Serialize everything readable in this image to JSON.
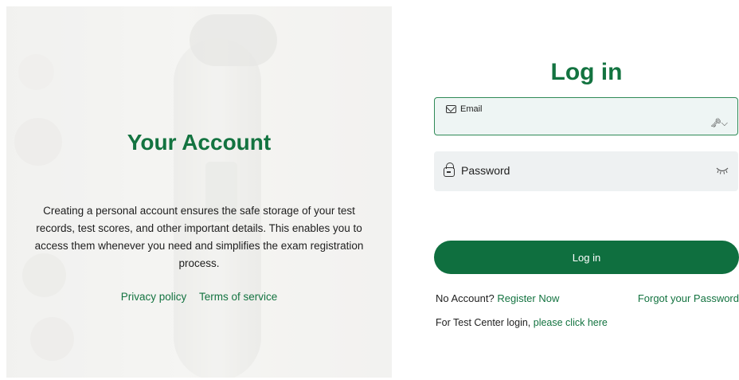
{
  "left_panel": {
    "title": "Your Account",
    "description": "Creating a personal account ensures the safe storage of your test records, test scores, and other important details. This enables you to access them whenever you need and simplifies the exam registration process.",
    "links": {
      "privacy": "Privacy policy",
      "terms": "Terms of service"
    }
  },
  "login": {
    "title": "Log in",
    "email_label": "Email",
    "password_label": "Password",
    "button_label": "Log in",
    "no_account_text": "No Account?",
    "register_link": "Register Now",
    "forgot_link": "Forgot your Password",
    "test_center_text": "For Test Center login,",
    "test_center_link": "please click here"
  },
  "colors": {
    "brand_green": "#137340",
    "button_green": "#0f6f3f",
    "field_bg": "#eef1f2"
  },
  "icons": {
    "email": "mail-icon",
    "password": "lock-icon",
    "email_suffix": "key-icon",
    "password_suffix": "eye-closed-icon"
  }
}
